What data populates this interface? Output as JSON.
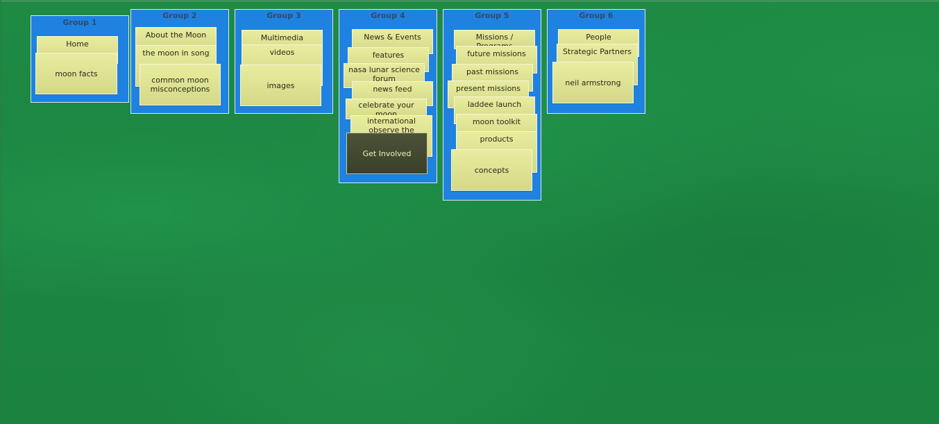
{
  "groups": [
    {
      "title": "Group 1",
      "cards": [
        {
          "label": "Home"
        },
        {
          "label": "moon facts"
        }
      ]
    },
    {
      "title": "Group 2",
      "cards": [
        {
          "label": "About the Moon"
        },
        {
          "label": "the moon in song"
        },
        {
          "label": "common moon misconceptions"
        }
      ]
    },
    {
      "title": "Group 3",
      "cards": [
        {
          "label": "Multimedia"
        },
        {
          "label": "videos"
        },
        {
          "label": "images"
        }
      ]
    },
    {
      "title": "Group 4",
      "cards": [
        {
          "label": "News & Events"
        },
        {
          "label": "features"
        },
        {
          "label": "nasa lunar science forum"
        },
        {
          "label": "news feed"
        },
        {
          "label": "celebrate your moon"
        },
        {
          "label": "international observe the moon"
        },
        {
          "label": "Get Involved"
        }
      ]
    },
    {
      "title": "Group 5",
      "cards": [
        {
          "label": "Missions / Programs"
        },
        {
          "label": "future missions"
        },
        {
          "label": "past missions"
        },
        {
          "label": "present missions"
        },
        {
          "label": "laddee launch"
        },
        {
          "label": "moon toolkit"
        },
        {
          "label": "products"
        },
        {
          "label": "concepts"
        }
      ]
    },
    {
      "title": "Group 6",
      "cards": [
        {
          "label": "People"
        },
        {
          "label": "Strategic Partners"
        },
        {
          "label": "neil armstrong"
        }
      ]
    }
  ]
}
